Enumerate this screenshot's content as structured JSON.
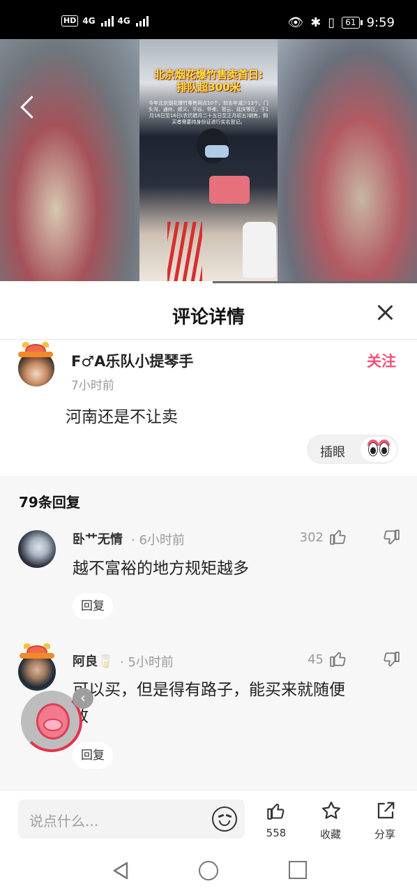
{
  "status_bar": {
    "hd": "HD",
    "net1": "4G",
    "net2": "4G",
    "battery": "61",
    "time": "9:59"
  },
  "video": {
    "title_line1": "北京烟花爆竹售卖首日:",
    "title_line2": "排队超300米",
    "subtitle": "今年北京烟花爆竹零售网点10个，较去年减少13个。门头沟、通州、顺义、平谷、怀柔、密云、延庆等区，于1月16日至16日(农历腊月二十五日至正月初五)销售，购买者需要持身份证进行实名登记。",
    "progress_percent": 51
  },
  "sheet": {
    "title": "评论详情"
  },
  "main_comment": {
    "username": "F♂A乐队小提琴手",
    "time": "7小时前",
    "follow_label": "关注",
    "text": "河南还是不让卖",
    "reaction_label": "插眼"
  },
  "replies": {
    "count_label": "79条回复",
    "items": [
      {
        "username": "卧艹无情",
        "time": "· 6小时前",
        "likes": "302",
        "text": "越不富裕的地方规矩越多",
        "reply_label": "回复"
      },
      {
        "username": "阿良🥛",
        "time": "· 5小时前",
        "likes": "45",
        "text_line1": "可以买，但是得有路子，能买来就随便",
        "text_line2": "放",
        "reply_label": "回复"
      }
    ]
  },
  "bottom_bar": {
    "input_placeholder": "说点什么...",
    "like_count": "558",
    "favorite_label": "收藏",
    "share_label": "分享"
  }
}
